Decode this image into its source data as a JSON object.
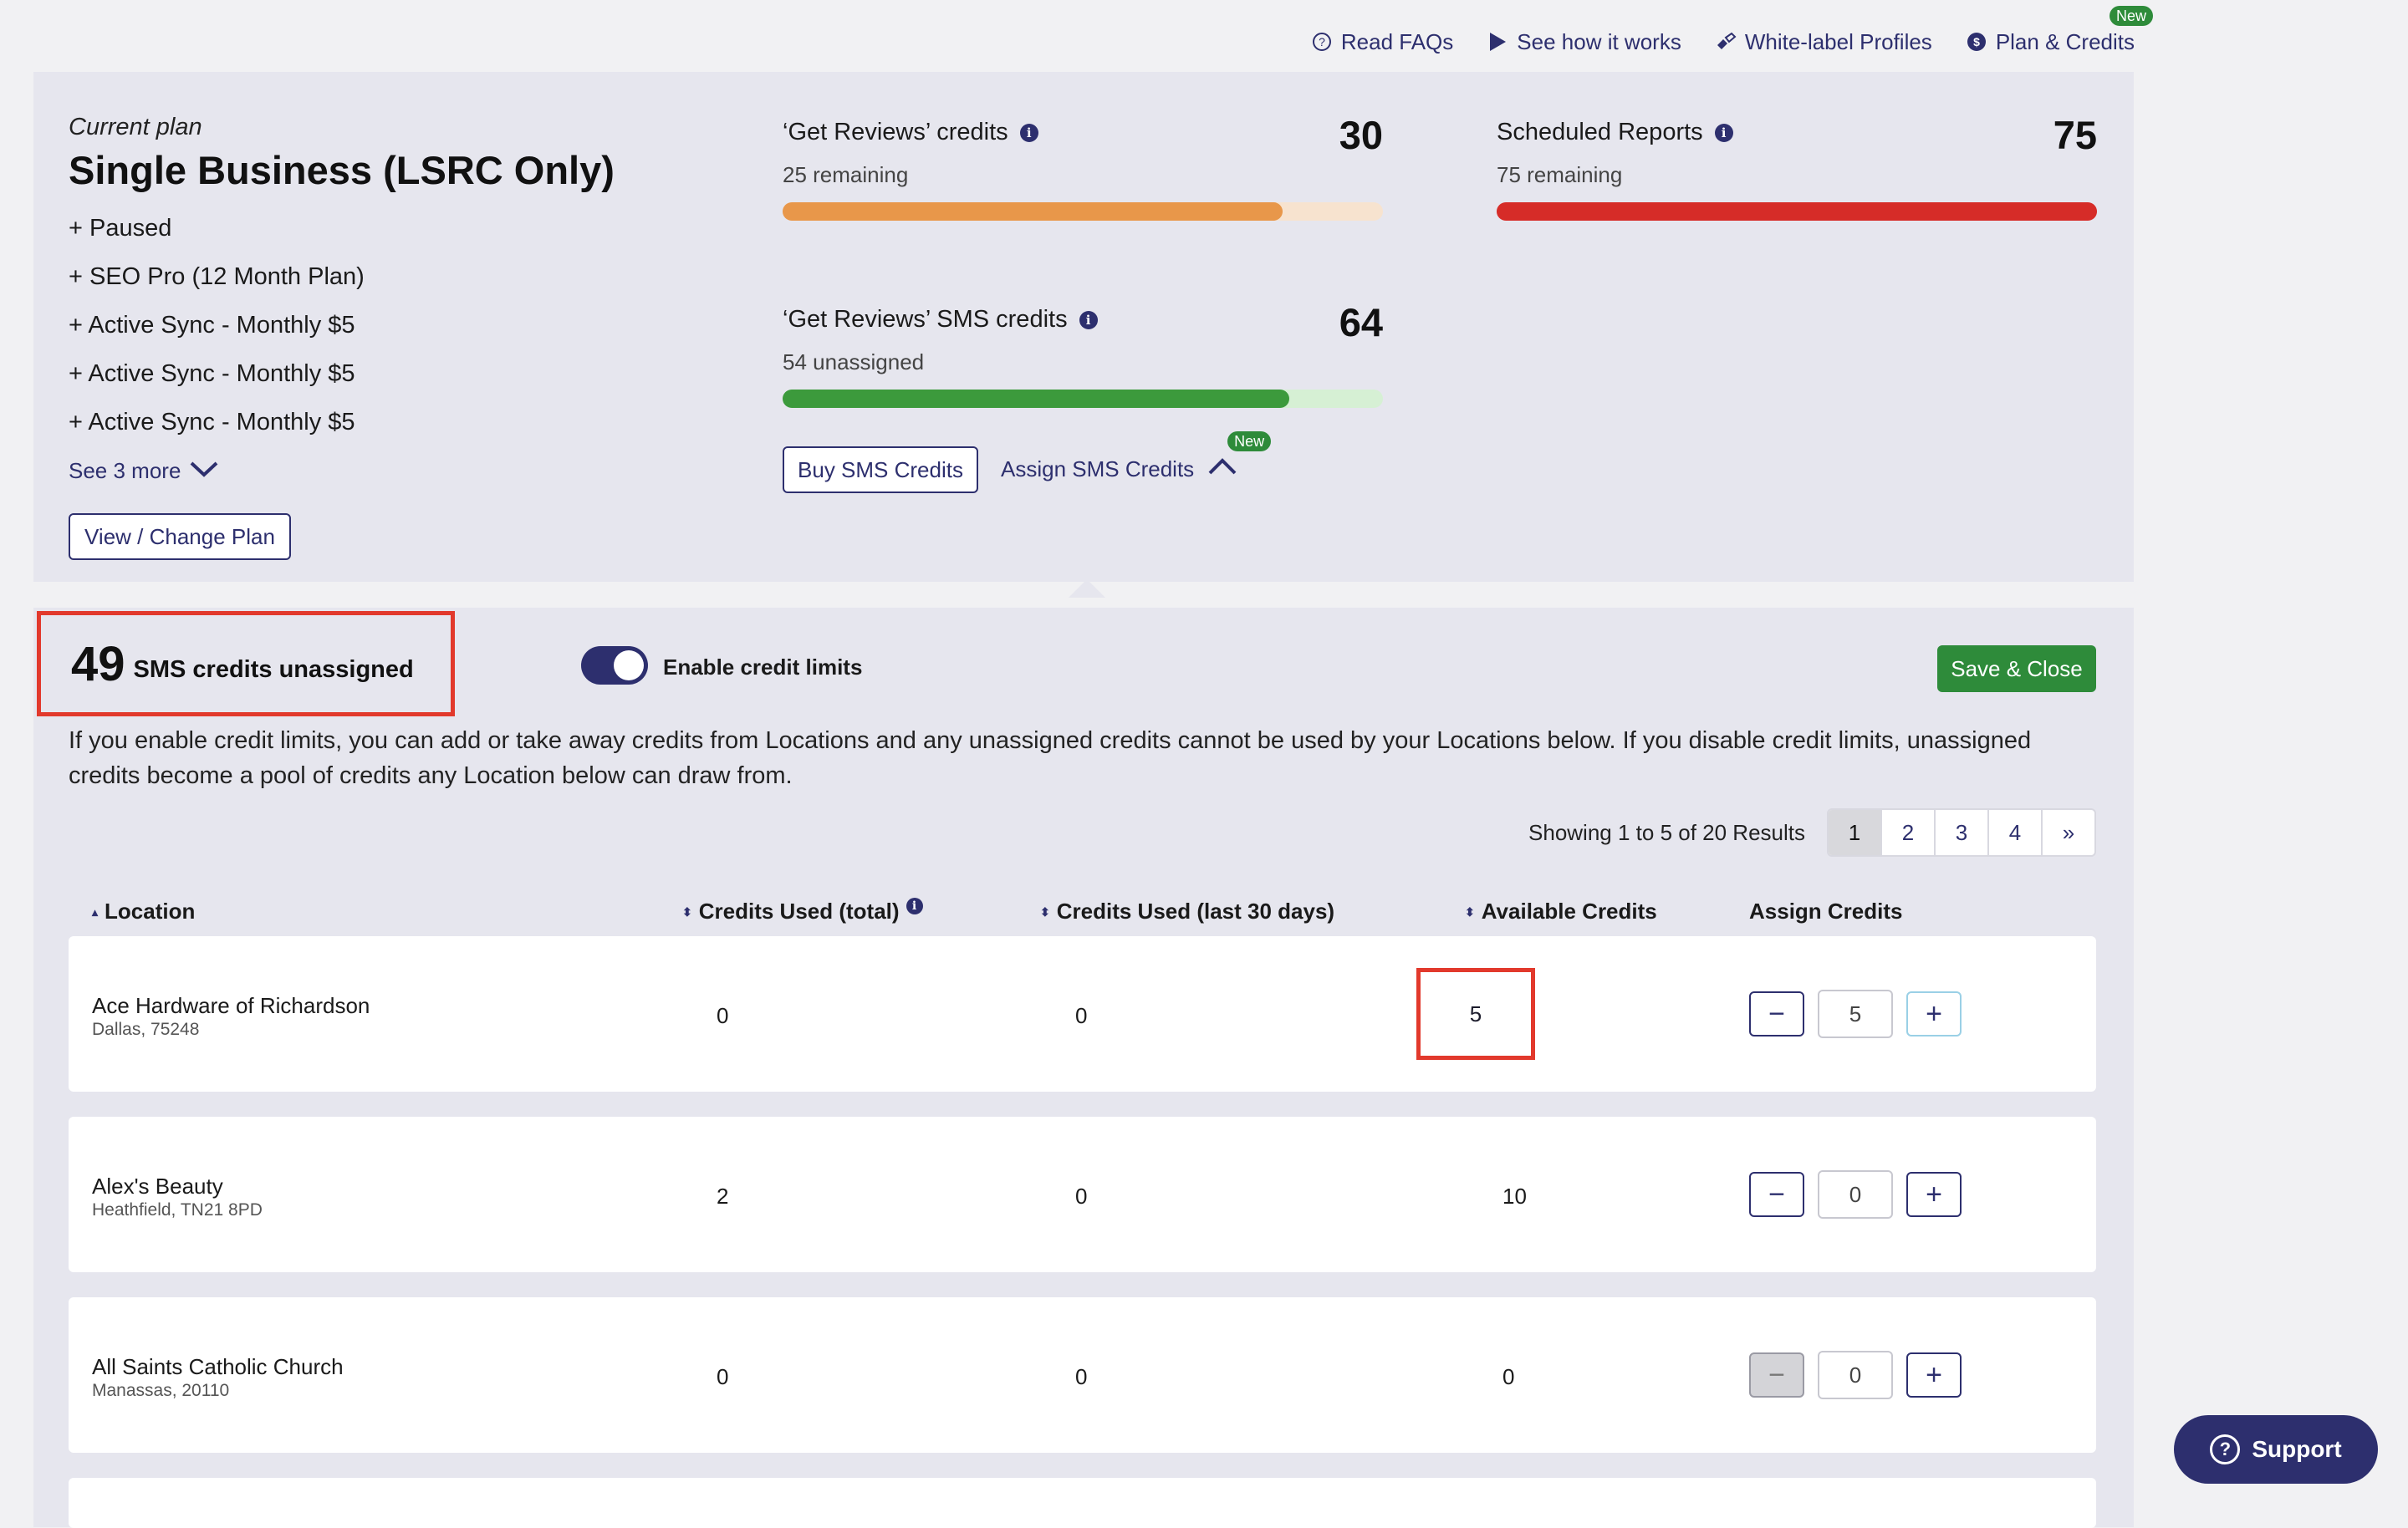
{
  "nav": {
    "items": [
      {
        "label": "Read FAQs",
        "icon": "question-circle-icon"
      },
      {
        "label": "See how it works",
        "icon": "play-icon"
      },
      {
        "label": "White-label Profiles",
        "icon": "brush-icon"
      },
      {
        "label": "Plan & Credits",
        "icon": "dollar-circle-icon",
        "badge": "New"
      }
    ]
  },
  "plan": {
    "label": "Current plan",
    "name": "Single Business (LSRC Only)",
    "addons": [
      "+ Paused",
      "+ SEO Pro (12 Month Plan)",
      "+ Active Sync - Monthly $5",
      "+ Active Sync - Monthly $5",
      "+ Active Sync - Monthly $5"
    ],
    "see_more": "See 3 more",
    "change_button": "View / Change Plan"
  },
  "credits": {
    "reviews": {
      "title": "‘Get Reviews’ credits",
      "total": "30",
      "sub": "25 remaining",
      "fill": 0.833,
      "color": "#e8974a",
      "track": "#f7e3cf"
    },
    "sms": {
      "title": "‘Get Reviews’ SMS credits",
      "total": "64",
      "sub": "54 unassigned",
      "fill": 0.844,
      "color": "#3c9a3c",
      "track": "#d6f0d4"
    },
    "reports": {
      "title": "Scheduled Reports",
      "total": "75",
      "sub": "75 remaining",
      "fill": 1.0,
      "color": "#d62c28",
      "track": "#f3cfcd"
    },
    "buy_sms": "Buy SMS Credits",
    "assign_sms": "Assign SMS Credits",
    "assign_badge": "New"
  },
  "assign": {
    "unassigned_count": "49",
    "unassigned_label": "SMS credits unassigned",
    "toggle_label": "Enable credit limits",
    "toggle_on": true,
    "save_close": "Save & Close",
    "explanation": "If you enable credit limits, you can add or take away credits from Locations and any unassigned credits cannot be used by your Locations below. If you disable credit limits, unassigned credits become a pool of credits any Location below can draw from.",
    "results_text": "Showing 1 to 5 of 20 Results",
    "pages": [
      "1",
      "2",
      "3",
      "4",
      "»"
    ],
    "active_page": "1",
    "columns": {
      "location": "Location",
      "used_total": "Credits Used (total)",
      "used_30": "Credits Used (last 30 days)",
      "available": "Available Credits",
      "assign": "Assign Credits"
    },
    "rows": [
      {
        "name": "Ace Hardware of Richardson",
        "sub": "Dallas, 75248",
        "used_total": "0",
        "used_30": "0",
        "available": "5",
        "assign": "5"
      },
      {
        "name": "Alex's Beauty",
        "sub": "Heathfield, TN21 8PD",
        "used_total": "2",
        "used_30": "0",
        "available": "10",
        "assign": "0"
      },
      {
        "name": "All Saints Catholic Church",
        "sub": "Manassas, 20110",
        "used_total": "0",
        "used_30": "0",
        "available": "0",
        "assign": "0"
      }
    ]
  },
  "support": {
    "label": "Support"
  },
  "colors": {
    "brand": "#2d2f6e",
    "success": "#2e8b3a",
    "highlight": "#e2392c"
  }
}
